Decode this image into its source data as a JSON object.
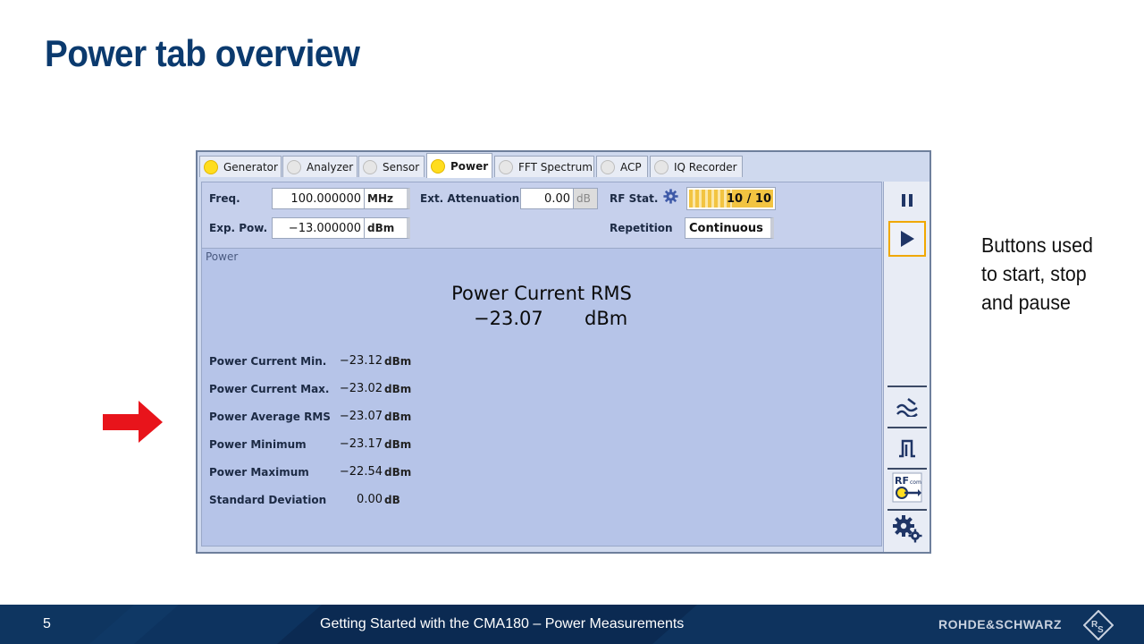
{
  "slide": {
    "title": "Power tab overview",
    "annotation_lines": [
      "Buttons used",
      "to start, stop",
      "and pause"
    ],
    "footer": {
      "page_number": "5",
      "text": "Getting Started with the CMA180 – Power Measurements",
      "brand": "ROHDE&SCHWARZ"
    }
  },
  "app": {
    "tabs": [
      {
        "label": "Generator",
        "indicator": "yellow",
        "active": false
      },
      {
        "label": "Analyzer",
        "indicator": "gray",
        "active": false
      },
      {
        "label": "Sensor",
        "indicator": "gray",
        "active": false
      },
      {
        "label": "Power",
        "indicator": "yellow",
        "active": true
      },
      {
        "label": "FFT Spectrum",
        "indicator": "gray",
        "active": false
      },
      {
        "label": "ACP",
        "indicator": "gray",
        "active": false
      },
      {
        "label": "IQ Recorder",
        "indicator": "gray",
        "active": false
      }
    ],
    "settings": {
      "freq_label": "Freq.",
      "freq_value": "100.000000",
      "freq_unit": "MHz",
      "ext_att_label": "Ext. Attenuation",
      "ext_att_value": "0.00",
      "ext_att_unit": "dB",
      "rf_stat_label": "RF Stat.",
      "rf_stat_value": "10 / 10",
      "rf_stat_progress": 1.0,
      "exp_pow_label": "Exp. Pow.",
      "exp_pow_value": "−13.000000",
      "exp_pow_unit": "dBm",
      "repetition_label": "Repetition",
      "repetition_value": "Continuous"
    },
    "section_label": "Power",
    "main_result": {
      "title": "Power Current RMS",
      "value": "−23.07",
      "unit": "dBm"
    },
    "results": [
      {
        "label": "Power Current Min.",
        "value": "−23.12",
        "unit": "dBm"
      },
      {
        "label": "Power Current Max.",
        "value": "−23.02",
        "unit": "dBm"
      },
      {
        "label": "Power Average RMS",
        "value": "−23.07",
        "unit": "dBm"
      },
      {
        "label": "Power Minimum",
        "value": "−23.17",
        "unit": "dBm"
      },
      {
        "label": "Power Maximum",
        "value": "−22.54",
        "unit": "dBm"
      },
      {
        "label": "Standard Deviation",
        "value": "0.00",
        "unit": "dB"
      }
    ],
    "sidebar_icons": [
      "pause-icon",
      "play-icon",
      "filter-icon",
      "pulse-icon",
      "rf-connect-icon",
      "settings-gears-icon"
    ],
    "colors": {
      "tab_on": "#ffdd1f",
      "highlight": "#f0a800",
      "title": "#0b3a6e",
      "arrow": "#e8141b"
    }
  }
}
